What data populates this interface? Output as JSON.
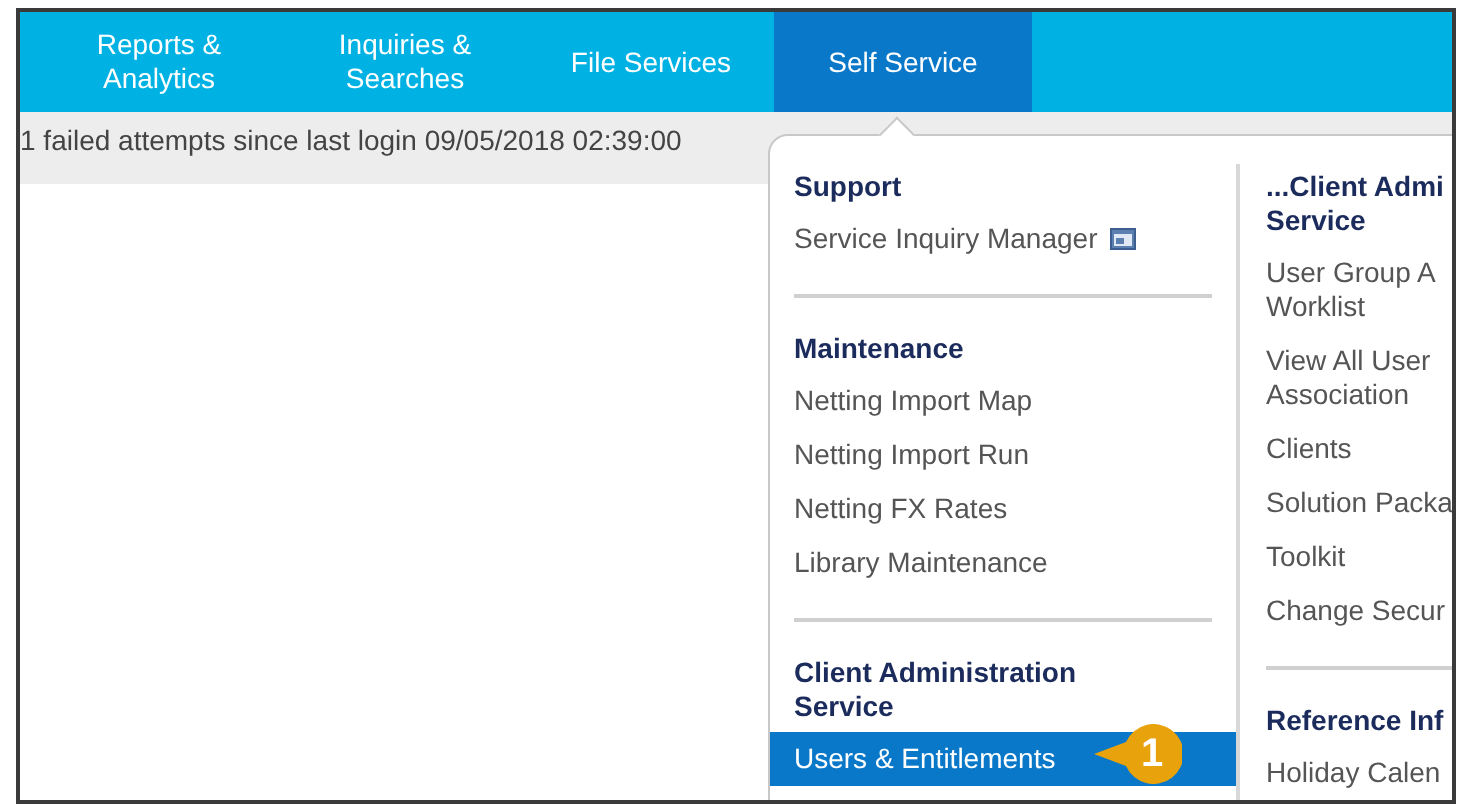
{
  "nav": {
    "tabs": [
      {
        "label": "Reports &\nAnalytics",
        "selected": false
      },
      {
        "label": "Inquiries &\nSearches",
        "selected": false
      },
      {
        "label": "File Services",
        "selected": false
      },
      {
        "label": "Self Service",
        "selected": true
      }
    ]
  },
  "notice": "1 failed attempts since last login 09/05/2018 02:39:00",
  "menu": {
    "columns": [
      {
        "sections": [
          {
            "heading": "Support",
            "items": [
              {
                "label": "Service Inquiry Manager",
                "kind": "external",
                "selected": false
              }
            ]
          },
          {
            "heading": "Maintenance",
            "items": [
              {
                "label": "Netting Import Map",
                "kind": "link",
                "selected": false
              },
              {
                "label": "Netting Import Run",
                "kind": "link",
                "selected": false
              },
              {
                "label": "Netting FX Rates",
                "kind": "link",
                "selected": false
              },
              {
                "label": "Library Maintenance",
                "kind": "link",
                "selected": false
              }
            ]
          },
          {
            "heading": "Client Administration\nService",
            "items": [
              {
                "label": "Users & Entitlements",
                "kind": "link",
                "selected": true,
                "callout": "1"
              }
            ]
          }
        ]
      },
      {
        "sections": [
          {
            "heading": "...Client Admi\nService",
            "items": [
              {
                "label": "User Group A\nWorklist",
                "kind": "link",
                "selected": false
              },
              {
                "label": "View All User\nAssociation",
                "kind": "link",
                "selected": false
              },
              {
                "label": "Clients",
                "kind": "link",
                "selected": false
              },
              {
                "label": "Solution Packa",
                "kind": "link",
                "selected": false
              },
              {
                "label": "Toolkit",
                "kind": "link",
                "selected": false
              },
              {
                "label": "Change Secur",
                "kind": "link",
                "selected": false
              }
            ]
          },
          {
            "heading": "Reference Inf",
            "items": [
              {
                "label": "Holiday Calen",
                "kind": "link",
                "selected": false
              }
            ]
          }
        ]
      }
    ]
  }
}
